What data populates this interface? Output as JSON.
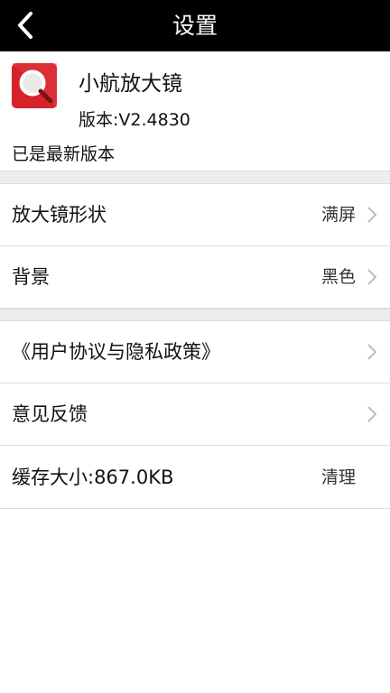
{
  "header": {
    "title": "设置",
    "back_icon": "chevron-left-icon"
  },
  "app": {
    "icon": "magnifier-app-icon",
    "name": "小航放大镜",
    "version": "版本:V2.4830",
    "update_status": "已是最新版本"
  },
  "settings": {
    "shape": {
      "label": "放大镜形状",
      "value": "满屏"
    },
    "background": {
      "label": "背景",
      "value": "黑色"
    }
  },
  "links": {
    "policy": {
      "label": "《用户协议与隐私政策》"
    },
    "feedback": {
      "label": "意见反馈"
    },
    "cache": {
      "label": "缓存大小:867.0KB",
      "action": "清理"
    }
  },
  "colors": {
    "header_bg": "#000000",
    "icon_red": "#d6232b",
    "divider_bg": "#ededed",
    "chevron": "#bdbdbd"
  }
}
